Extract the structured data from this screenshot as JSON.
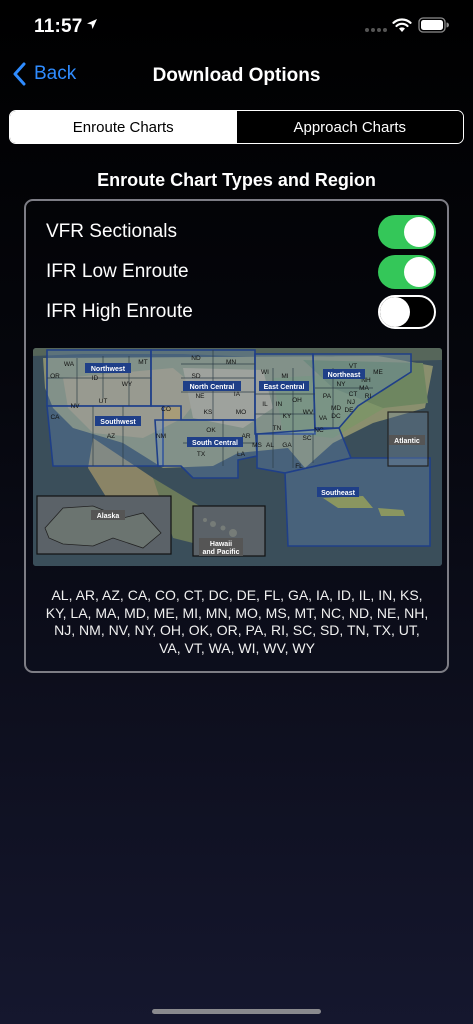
{
  "status_bar": {
    "time": "11:57"
  },
  "nav": {
    "back_label": "Back",
    "title": "Download Options"
  },
  "tabs": [
    {
      "label": "Enroute Charts",
      "selected": true
    },
    {
      "label": "Approach Charts",
      "selected": false
    }
  ],
  "section_title": "Enroute Chart Types and Region",
  "toggles": [
    {
      "label": "VFR Sectionals",
      "on": true
    },
    {
      "label": "IFR Low Enroute",
      "on": true
    },
    {
      "label": "IFR High Enroute",
      "on": false
    }
  ],
  "map": {
    "regions": [
      "Northwest",
      "North Central",
      "East Central",
      "Northeast",
      "Southwest",
      "South Central",
      "Southeast",
      "Atlantic",
      "Alaska",
      "Hawaii",
      "and Pacific"
    ],
    "states": [
      "WA",
      "MT",
      "ND",
      "MN",
      "OR",
      "ID",
      "SD",
      "WI",
      "WY",
      "NE",
      "IA",
      "NV",
      "UT",
      "CO",
      "KS",
      "MO",
      "IL",
      "IN",
      "OH",
      "CA",
      "AZ",
      "NM",
      "OK",
      "AR",
      "TN",
      "KY",
      "TX",
      "LA",
      "MS",
      "AL",
      "GA",
      "SC",
      "NC",
      "VA",
      "WV",
      "FL",
      "PA",
      "NY",
      "MI",
      "ME",
      "VT",
      "NH",
      "MA",
      "CT",
      "NJ",
      "MD",
      "DE",
      "RI",
      "DC"
    ]
  },
  "states_list": "AL, AR, AZ, CA, CO, CT, DC, DE, FL, GA, IA, ID, IL, IN, KS, KY, LA, MA, MD, ME, MI, MN, MO, MS, MT, NC, ND, NE, NH, NJ, NM, NV, NY, OH, OK, OR, PA, RI, SC, SD, TN, TX, UT, VA, VT, WA, WI, WV, WY",
  "colors": {
    "accent": "#2f8cff",
    "switch_on": "#34c759"
  }
}
